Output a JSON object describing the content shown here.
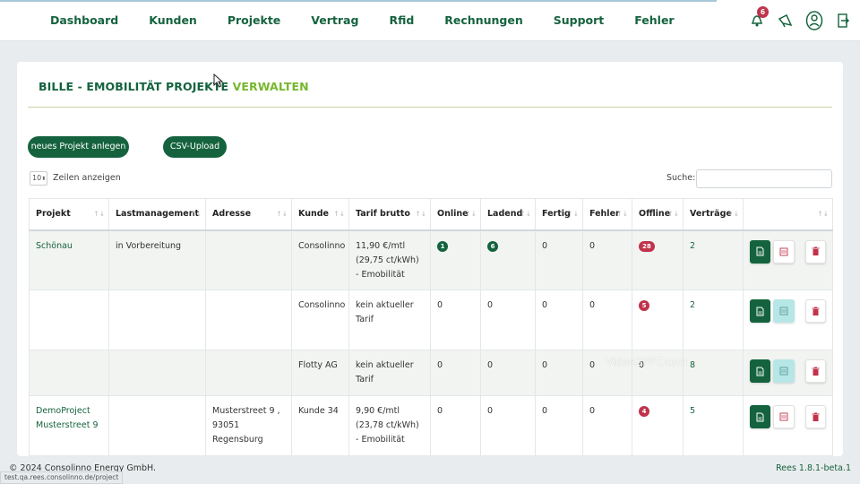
{
  "nav": {
    "items": [
      "Dashboard",
      "Kunden",
      "Projekte",
      "Vertrag",
      "Rfid",
      "Rechnungen",
      "Support",
      "Fehler"
    ],
    "notifications_count": "6",
    "icons": [
      "bell-icon",
      "megaphone-icon",
      "user-icon",
      "logout-icon"
    ]
  },
  "page": {
    "title_part1": "BILLE - EMOBILITÄT PROJEKTE",
    "title_part2": " VERWALTEN",
    "new_project_button": "neues Projekt anlegen",
    "csv_upload_button": "CSV-Upload",
    "page_length": "10",
    "page_length_suffix": "Zeilen anzeigen",
    "search_label": "Suche:",
    "search_value": ""
  },
  "table": {
    "headers": [
      "Projekt",
      "Lastmanagement",
      "Adresse",
      "Kunde",
      "Tarif brutto",
      "Online",
      "Ladend",
      "Fertig",
      "Fehler",
      "Offline",
      "Verträge",
      ""
    ],
    "rows": [
      {
        "projekt": "Schönau",
        "lastmanagement": "in Vorbereitung",
        "adresse": "",
        "kunde": "Consolinno",
        "tarif": "11,90 €/mtl (29,75 ct/kWh) - Emobilität",
        "online": "1",
        "ladend": "6",
        "fertig": "0",
        "fehler": "0",
        "offline": "28",
        "vertraege": "2"
      },
      {
        "projekt": "",
        "lastmanagement": "",
        "adresse": "",
        "kunde": "Consolinno",
        "tarif": "kein aktueller Tarif",
        "online": "0",
        "ladend": "0",
        "fertig": "0",
        "fehler": "0",
        "offline": "5",
        "vertraege": "2"
      },
      {
        "projekt": "",
        "lastmanagement": "",
        "adresse": "",
        "kunde": "Flotty AG",
        "tarif": "kein aktueller Tarif",
        "online": "0",
        "ladend": "0",
        "fertig": "0",
        "fehler": "0",
        "offline": "0",
        "vertraege": "8"
      },
      {
        "projekt": "DemoProject Musterstreet 9",
        "lastmanagement": "",
        "adresse": "Musterstreet 9 , 93051 Regensburg",
        "kunde": "Kunde 34",
        "tarif": "9,90 €/mtl (23,78 ct/kWh) - Emobilität",
        "online": "0",
        "ladend": "0",
        "fertig": "0",
        "fehler": "0",
        "offline": "4",
        "vertraege": "5"
      }
    ]
  },
  "footer": {
    "copyright": "© 2024 Consolinno Energy GmbH.",
    "version": "Rees 1.8.1-beta.1",
    "status_url": "test.qa.rees.consolinno.de/project"
  },
  "watermark": "Video2PPT.com",
  "colors": {
    "brand_green": "#15633e",
    "accent_green": "#77b82e",
    "badge_red": "#c0334b",
    "teal": "#b7e6e6"
  }
}
